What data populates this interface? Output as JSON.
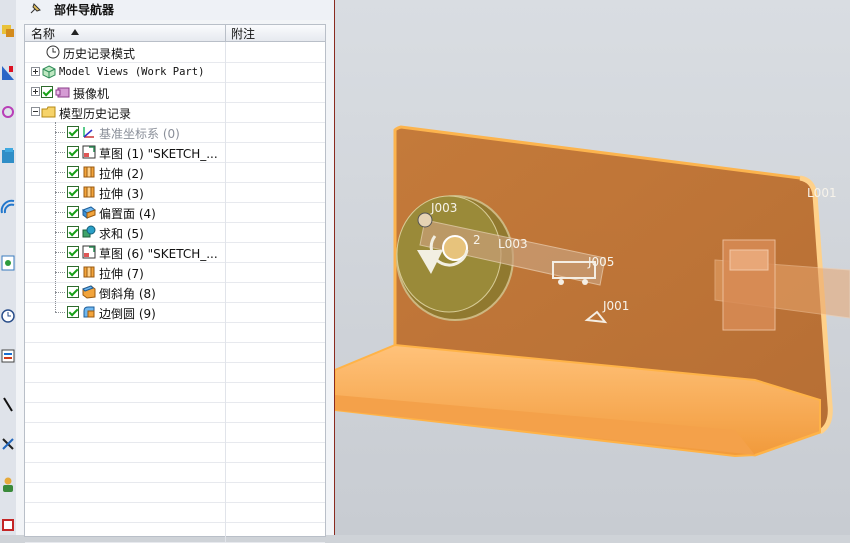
{
  "navigator": {
    "title": "部件导航器",
    "columns": {
      "name": "名称",
      "note": "附注"
    },
    "rows": [
      {
        "label": "历史记录模式",
        "icon": "clock-icon",
        "indent": 1,
        "expander": "none",
        "check": false,
        "mono": false,
        "disabled": false
      },
      {
        "label": "Model Views (Work Part)",
        "icon": "model-views-icon",
        "indent": 0,
        "expander": "plus",
        "check": false,
        "mono": true,
        "disabled": false
      },
      {
        "label": "摄像机",
        "icon": "camera-icon",
        "indent": 0,
        "expander": "plus",
        "check": true,
        "mono": false,
        "disabled": false
      },
      {
        "label": "模型历史记录",
        "icon": "folder-icon",
        "indent": 0,
        "expander": "minus",
        "check": false,
        "mono": false,
        "disabled": false
      },
      {
        "label": "基准坐标系 (0)",
        "icon": "datum-csys-icon",
        "indent": 2,
        "expander": "none",
        "check": true,
        "mono": false,
        "disabled": true
      },
      {
        "label": "草图 (1) \"SKETCH_...",
        "icon": "sketch-icon",
        "indent": 2,
        "expander": "none",
        "check": true,
        "mono": false,
        "disabled": false
      },
      {
        "label": "拉伸 (2)",
        "icon": "extrude-icon",
        "indent": 2,
        "expander": "none",
        "check": true,
        "mono": false,
        "disabled": false
      },
      {
        "label": "拉伸 (3)",
        "icon": "extrude-icon",
        "indent": 2,
        "expander": "none",
        "check": true,
        "mono": false,
        "disabled": false
      },
      {
        "label": "偏置面 (4)",
        "icon": "offset-face-icon",
        "indent": 2,
        "expander": "none",
        "check": true,
        "mono": false,
        "disabled": false
      },
      {
        "label": "求和 (5)",
        "icon": "unite-icon",
        "indent": 2,
        "expander": "none",
        "check": true,
        "mono": false,
        "disabled": false
      },
      {
        "label": "草图 (6) \"SKETCH_...",
        "icon": "sketch-icon",
        "indent": 2,
        "expander": "none",
        "check": true,
        "mono": false,
        "disabled": false
      },
      {
        "label": "拉伸 (7)",
        "icon": "extrude-icon",
        "indent": 2,
        "expander": "none",
        "check": true,
        "mono": false,
        "disabled": false
      },
      {
        "label": "倒斜角 (8)",
        "icon": "chamfer-icon",
        "indent": 2,
        "expander": "none",
        "check": true,
        "mono": false,
        "disabled": false
      },
      {
        "label": "边倒圆 (9)",
        "icon": "edge-blend-icon",
        "indent": 2,
        "expander": "none",
        "check": true,
        "mono": false,
        "disabled": false
      }
    ]
  },
  "viewport": {
    "labels": {
      "j003": "J003",
      "j002": "2",
      "l003": "L003",
      "j005": "J005",
      "j001": "J001",
      "l001": "L001"
    },
    "colors": {
      "body": "#f5a34a",
      "edge": "#ffb347",
      "highlight": "#ffd18a"
    }
  }
}
